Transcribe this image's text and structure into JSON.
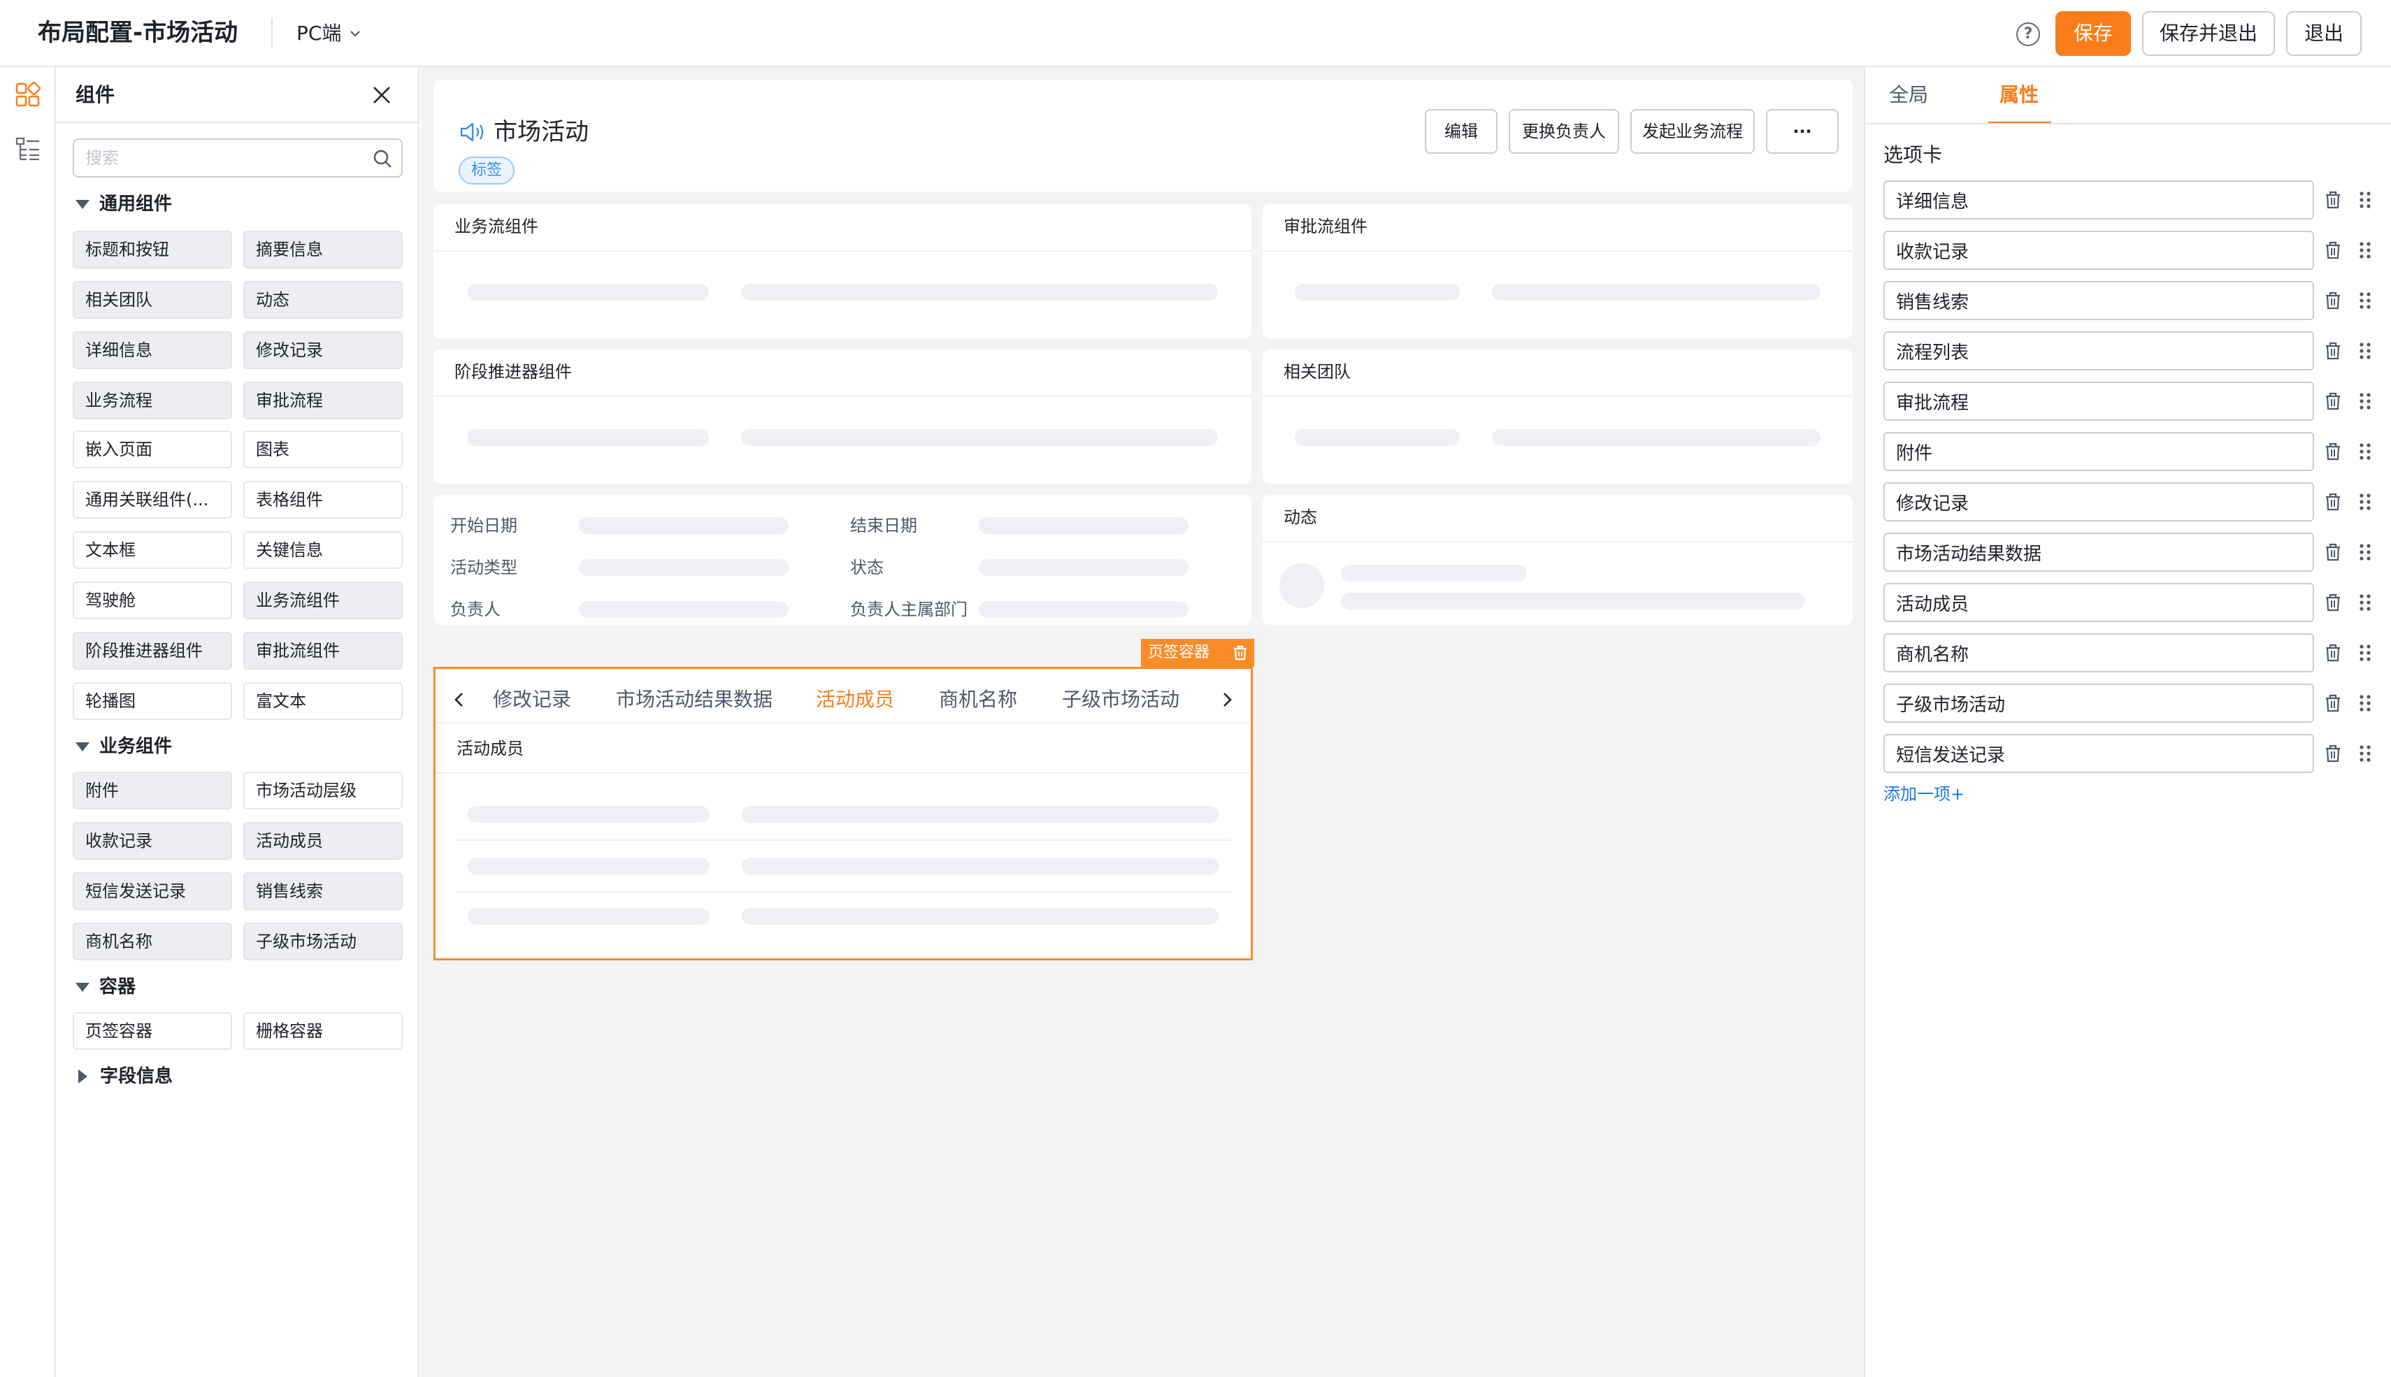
{
  "header": {
    "title": "布局配置-市场活动",
    "platform": "PC端",
    "help": "?",
    "save": "保存",
    "save_exit": "保存并退出",
    "exit": "退出"
  },
  "left": {
    "title": "组件",
    "search_placeholder": "搜索",
    "sections": {
      "general": "通用组件",
      "business": "业务组件",
      "container": "容器",
      "fields": "字段信息"
    },
    "general": [
      "标题和按钮",
      "摘要信息",
      "相关团队",
      "动态",
      "详细信息",
      "修改记录",
      "业务流程",
      "审批流程",
      "嵌入页面",
      "图表",
      "通用关联组件(...",
      "表格组件",
      "文本框",
      "关键信息",
      "驾驶舱",
      "业务流组件",
      "阶段推进器组件",
      "审批流组件",
      "轮播图",
      "富文本"
    ],
    "business": [
      "附件",
      "市场活动层级",
      "收款记录",
      "活动成员",
      "短信发送记录",
      "销售线索",
      "商机名称",
      "子级市场活动"
    ],
    "container": [
      "页签容器",
      "栅格容器"
    ]
  },
  "canvas": {
    "header": {
      "title": "市场活动",
      "tag": "标签",
      "buttons": [
        "编辑",
        "更换负责人",
        "发起业务流程",
        "···"
      ]
    },
    "cards": {
      "business_flow": "业务流组件",
      "approval_flow": "审批流组件",
      "stage": "阶段推进器组件",
      "team": "相关团队",
      "activity": "动态"
    },
    "fields": [
      "开始日期",
      "结束日期",
      "活动类型",
      "状态",
      "负责人",
      "负责人主属部门"
    ],
    "tab_container": {
      "badge": "页签容器",
      "tabs": [
        "修改记录",
        "市场活动结果数据",
        "活动成员",
        "商机名称",
        "子级市场活动"
      ],
      "active_index": 2,
      "section_title": "活动成员"
    }
  },
  "right": {
    "tabs": [
      "全局",
      "属性"
    ],
    "active_tab": "属性",
    "label": "选项卡",
    "options": [
      "详细信息",
      "收款记录",
      "销售线索",
      "流程列表",
      "审批流程",
      "附件",
      "修改记录",
      "市场活动结果数据",
      "活动成员",
      "商机名称",
      "子级市场活动",
      "短信发送记录"
    ],
    "add": "添加一项+"
  },
  "colors": {
    "accent": "#fa7d1b",
    "link": "#1f75e0",
    "tag": "#3b8ee8"
  }
}
